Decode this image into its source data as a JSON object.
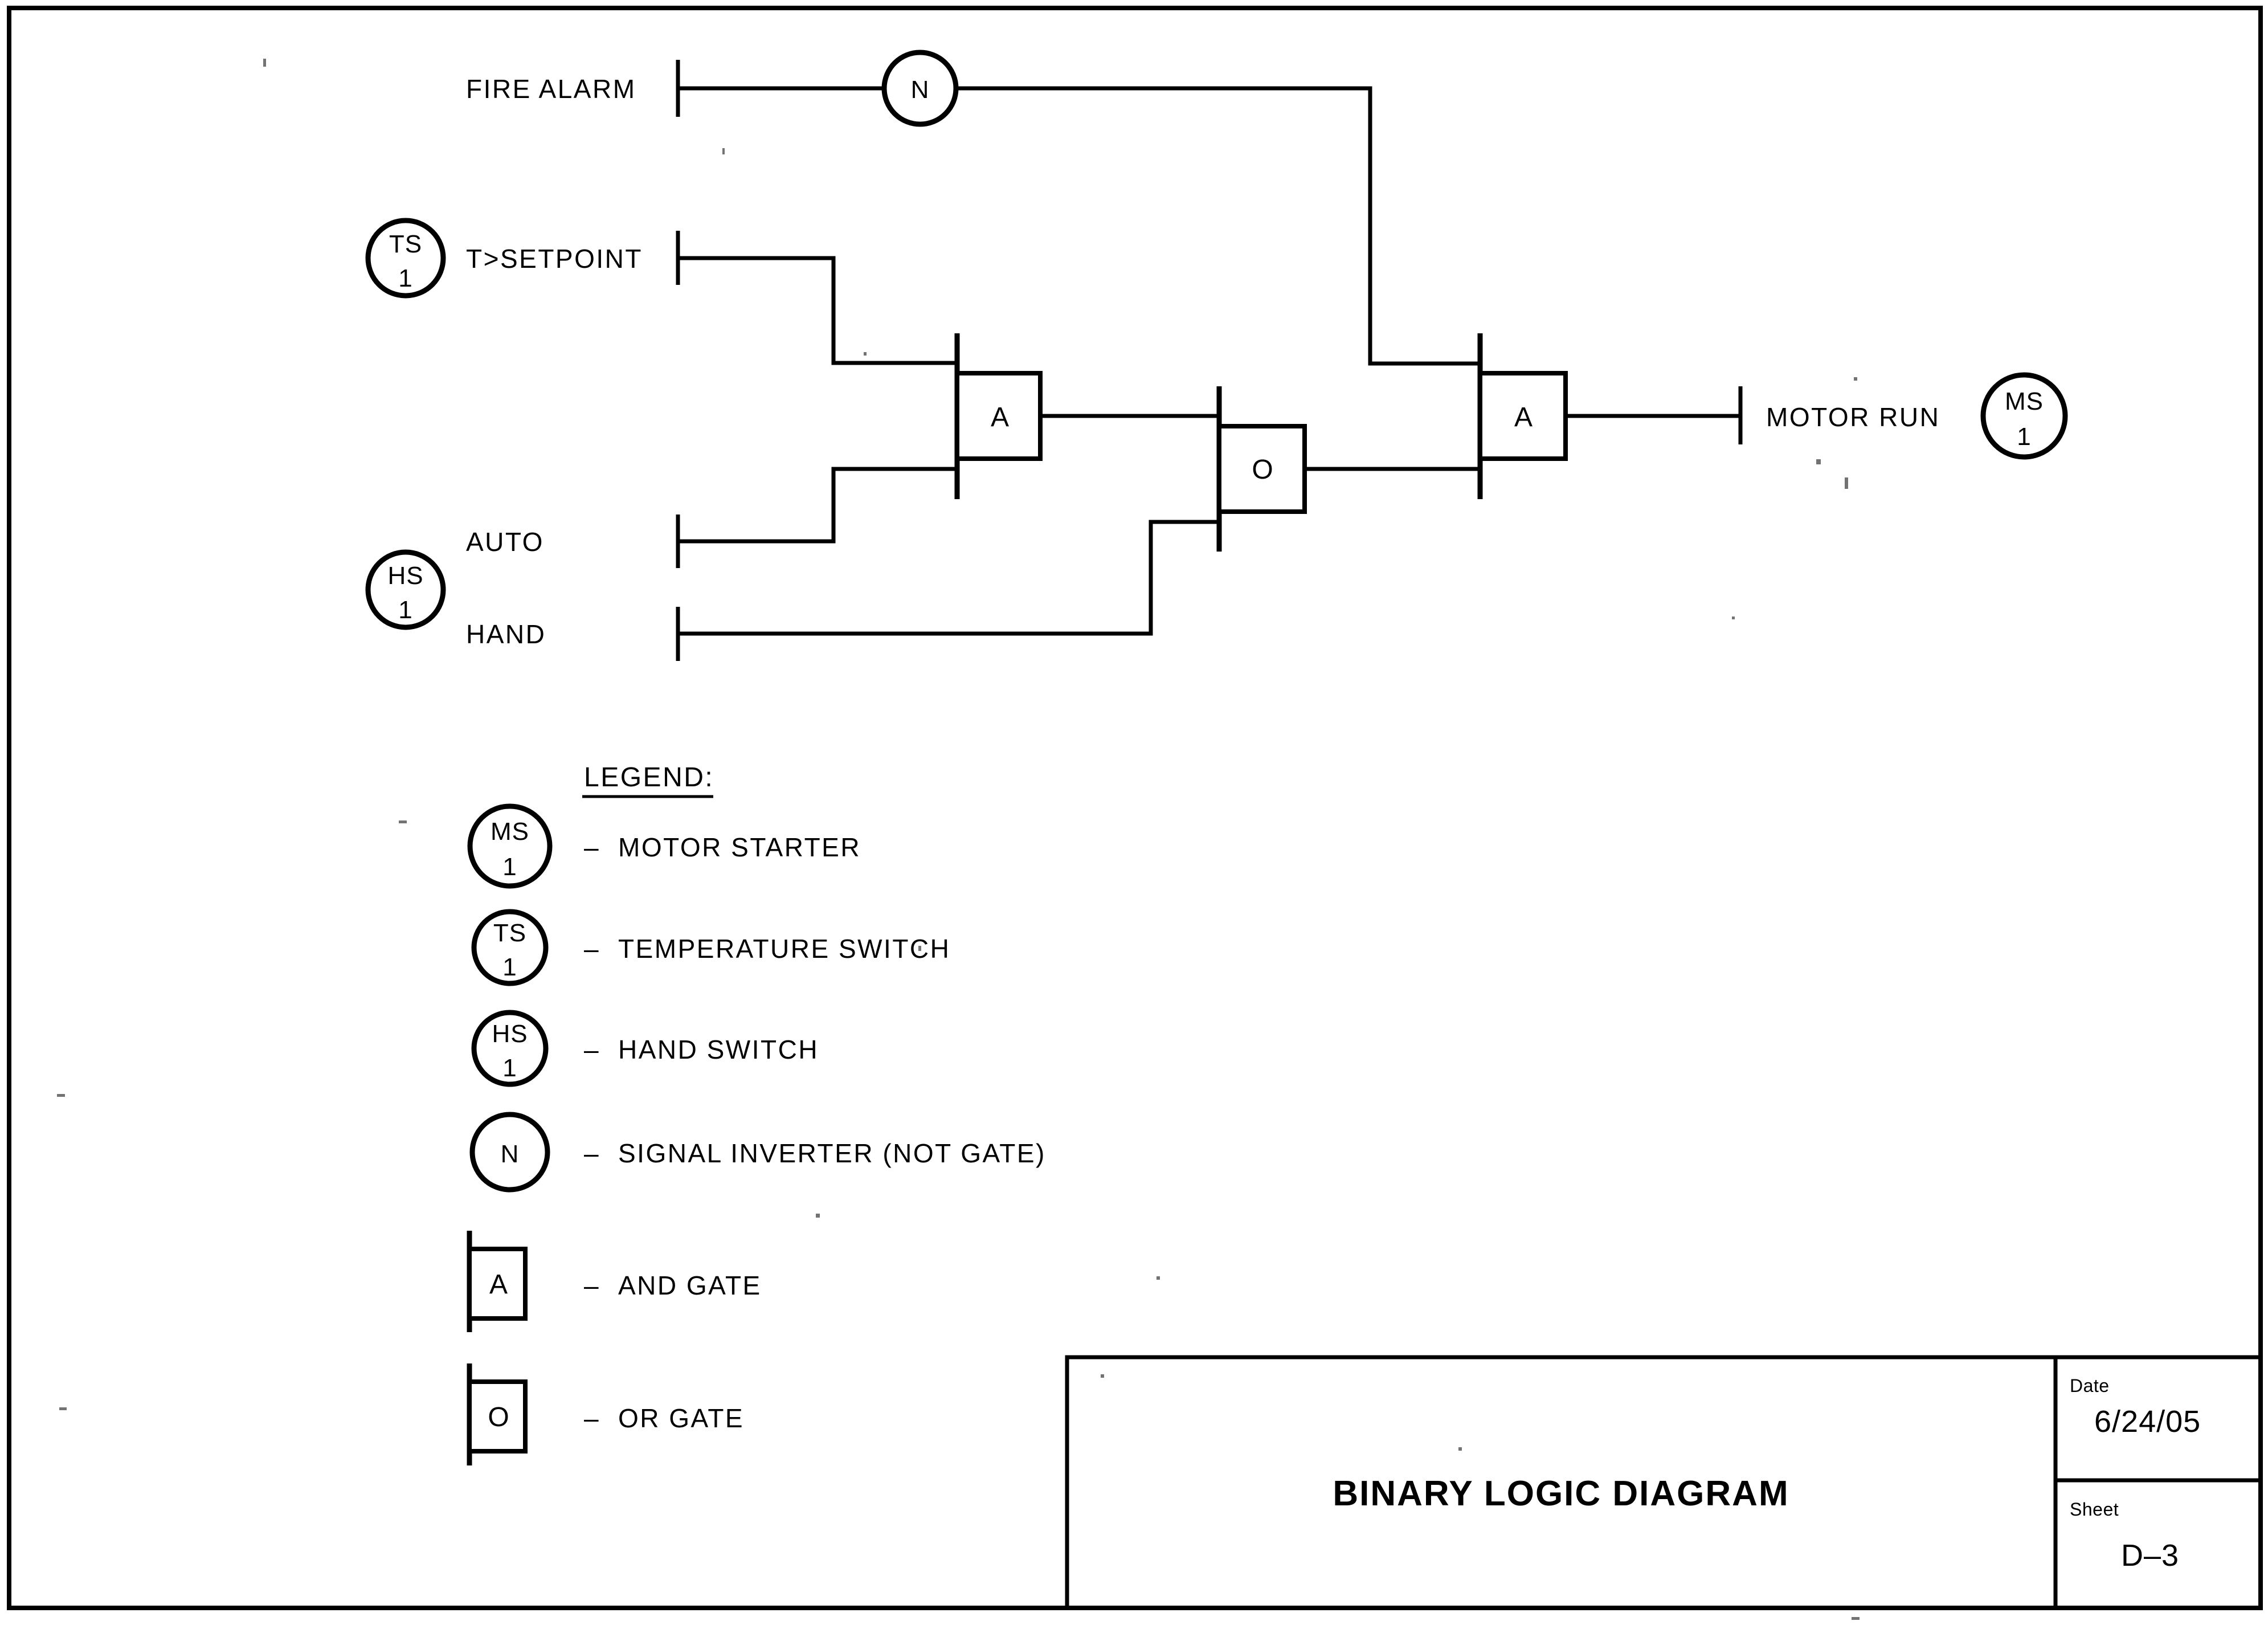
{
  "sheet": {
    "border_color": "#000000",
    "background": "#ffffff"
  },
  "diagram": {
    "inputs": [
      {
        "label": "FIRE ALARM",
        "tag": null
      },
      {
        "label": "T>SETPOINT",
        "tag": {
          "top": "TS",
          "bottom": "1"
        }
      },
      {
        "label": "AUTO",
        "tag": {
          "top": "HS",
          "bottom": "1"
        }
      },
      {
        "label": "HAND",
        "tag": null
      }
    ],
    "inverter": {
      "symbol": "N"
    },
    "gate_and_1": {
      "symbol": "A"
    },
    "gate_or_1": {
      "symbol": "O"
    },
    "gate_and_2": {
      "symbol": "A"
    },
    "output": {
      "label": "MOTOR RUN",
      "tag": {
        "top": "MS",
        "bottom": "1"
      }
    }
  },
  "legend": {
    "title": "LEGEND:",
    "dash": "–",
    "items": [
      {
        "symbol_type": "circle",
        "symbol_top": "MS",
        "symbol_bottom": "1",
        "text": "MOTOR STARTER"
      },
      {
        "symbol_type": "circle",
        "symbol_top": "TS",
        "symbol_bottom": "1",
        "text": "TEMPERATURE SWITCH"
      },
      {
        "symbol_type": "circle",
        "symbol_top": "HS",
        "symbol_bottom": "1",
        "text": "HAND SWITCH"
      },
      {
        "symbol_type": "circle",
        "symbol_top": "N",
        "symbol_bottom": "",
        "text": "SIGNAL INVERTER (NOT GATE)"
      },
      {
        "symbol_type": "box",
        "symbol_top": "A",
        "symbol_bottom": "",
        "text": "AND GATE"
      },
      {
        "symbol_type": "box",
        "symbol_top": "O",
        "symbol_bottom": "",
        "text": "OR GATE"
      }
    ]
  },
  "title_block": {
    "title": "BINARY LOGIC DIAGRAM",
    "date_label": "Date",
    "date_value": "6/24/05",
    "sheet_label": "Sheet",
    "sheet_value": "D–3"
  }
}
